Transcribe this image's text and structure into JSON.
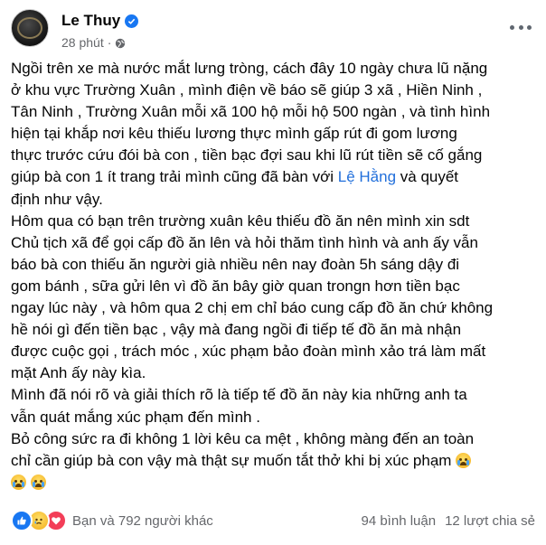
{
  "post": {
    "author": "Le Thuy",
    "time": "28 phút",
    "separator": "·",
    "paragraphs": [
      {
        "lines": [
          "Ngồi trên xe mà nước mắt lưng tròng, cách đây 10 ngày chưa lũ nặng",
          "ở khu vực Trường Xuân , mình điện về báo sẽ giúp 3 xã , Hiền Ninh ,",
          "Tân Ninh , Trường Xuân mỗi xã 100 hộ mỗi hộ 500 ngàn , và tình hình",
          "hiện tại khắp nơi kêu thiếu lương thực mình gấp rút đi gom lương",
          "thực trước cứu đói bà con , tiền bạc đợi sau khi lũ rút tiền sẽ cố gắng"
        ],
        "line6_before": "giúp bà con 1 ít trang trải mình cũng đã bàn với ",
        "mention": "Lệ Hằng",
        "line6_after": " và quyết",
        "line7": "định như vậy."
      },
      {
        "lines": [
          "Hôm qua có bạn trên trường xuân kêu thiếu đồ ăn nên mình xin sdt",
          "Chủ tịch xã để gọi cấp đồ ăn lên và hỏi thăm tình hình và anh ấy vẫn",
          "báo bà con thiếu ăn người già nhiều nên nay đoàn 5h sáng dậy đi",
          "gom bánh , sữa gửi lên vì đồ ăn bây giờ quan trongn hơn tiền bạc",
          "ngay lúc này , và hôm qua 2 chị em chỉ báo cung cấp đồ ăn chứ không",
          "hề nói gì đến tiền bạc , vậy mà đang ngồi đi tiếp tế đồ ăn mà nhận",
          "được cuộc gọi , trách móc , xúc phạm bảo đoàn mình xảo trá làm mất",
          "mặt Anh ấy này kìa."
        ]
      },
      {
        "lines": [
          "Mình đã nói rõ và giải thích rõ là tiếp tế đồ ăn này kia những anh ta",
          "vẫn quát mắng xúc phạm đến mình ."
        ]
      },
      {
        "lines": [
          "Bỏ công sức ra đi không 1 lời kêu ca mệt , không màng đến an toàn"
        ],
        "last_line": "chỉ cần giúp bà con vậy mà thật sự muốn tắt thở khi bị xúc phạm"
      }
    ],
    "emoji_name": "crying-face-emoji",
    "reactions": {
      "icons": [
        "like-icon",
        "sad-icon",
        "love-icon"
      ],
      "text": "Bạn và 792 người khác",
      "colors": {
        "like": "#1877f2",
        "love": "#f33e58"
      }
    },
    "comments": "94 bình luận",
    "shares": "12 lượt chia sẻ"
  }
}
